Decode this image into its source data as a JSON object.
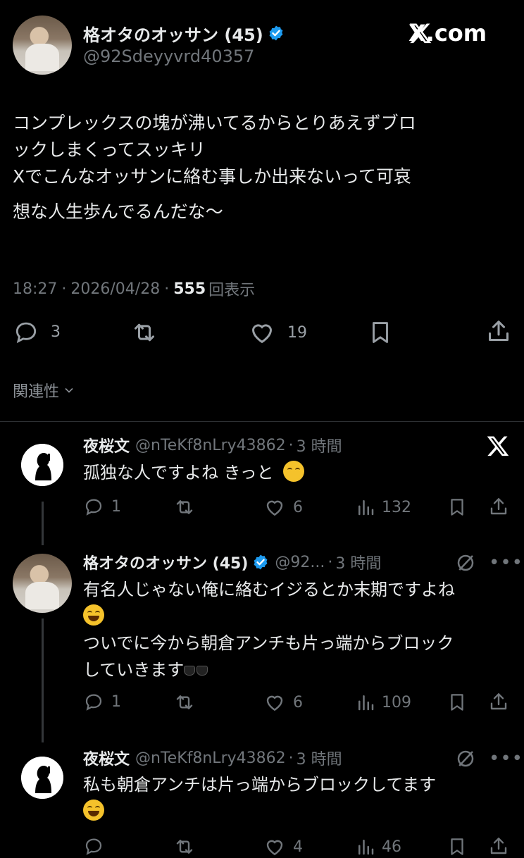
{
  "main_post": {
    "author_name": "格オタのオッサン (45)",
    "handle": "@92Sdeyyvrd40357",
    "brand": "X.com",
    "text_lines": [
      "コンプレックスの塊が沸いてるからとりあえずブロ",
      "ックしまくってスッキリ",
      "Xでこんなオッサンに絡む事しか出来ないって可哀",
      "想な人生歩んでるんだな〜"
    ],
    "time": "18:27",
    "date": "2026/04/28",
    "views": "555",
    "views_label": "回表示",
    "replies": "3",
    "likes": "19",
    "related_label": "関連性"
  },
  "replies": [
    {
      "author_name": "夜桜文",
      "handle": "@nTeKf8nLry43862",
      "time": "3 時間",
      "text": "孤独な人ですよね  きっと",
      "replies": "1",
      "likes": "6",
      "views": "132"
    },
    {
      "author_name": "格オタのオッサン (45)",
      "handle": "@92...",
      "time": "3 時間",
      "line1": "有名人じゃない俺に絡むイジるとか末期ですよね",
      "line2": "ついでに今から朝倉アンチも片っ端からブロック",
      "line3": "していきます",
      "replies": "1",
      "likes": "6",
      "views": "109"
    },
    {
      "author_name": "夜桜文",
      "handle": "@nTeKf8nLry43862",
      "time": "3 時間",
      "line1": "私も朝倉アンチは片っ端からブロックしてます",
      "partial_likes": "4",
      "partial_views": "46"
    }
  ],
  "colors": {
    "background": "#000000",
    "text": "#e7e9ea",
    "muted": "#71767b",
    "verified": "#1d9bf0"
  }
}
